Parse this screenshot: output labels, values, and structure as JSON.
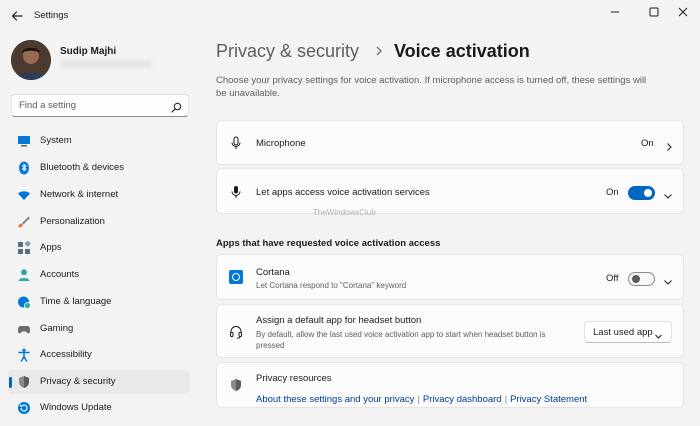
{
  "window": {
    "title": "Settings"
  },
  "user": {
    "name": "Sudip Majhi",
    "email": "sudipmajhi@hotmail.com"
  },
  "search": {
    "placeholder": "Find a setting"
  },
  "nav": [
    {
      "label": "System",
      "icon": "monitor-icon",
      "color": "#0078d4"
    },
    {
      "label": "Bluetooth & devices",
      "icon": "bluetooth-icon",
      "color": "#0078d4"
    },
    {
      "label": "Network & internet",
      "icon": "wifi-icon",
      "color": "#0078d4"
    },
    {
      "label": "Personalization",
      "icon": "paintbrush-icon",
      "color": "#e3733d"
    },
    {
      "label": "Apps",
      "icon": "apps-icon",
      "color": "#5c6b7a"
    },
    {
      "label": "Accounts",
      "icon": "person-icon",
      "color": "#2ea8a8"
    },
    {
      "label": "Time & language",
      "icon": "globe-clock-icon",
      "color": "#0078d4"
    },
    {
      "label": "Gaming",
      "icon": "gamepad-icon",
      "color": "#6b6b6b"
    },
    {
      "label": "Accessibility",
      "icon": "accessibility-icon",
      "color": "#0078d4"
    },
    {
      "label": "Privacy & security",
      "icon": "shield-icon",
      "color": "#6b6b6b",
      "selected": true
    },
    {
      "label": "Windows Update",
      "icon": "update-icon",
      "color": "#0078d4"
    }
  ],
  "breadcrumb": {
    "parent": "Privacy & security",
    "current": "Voice activation"
  },
  "description": "Choose your privacy settings for voice activation. If microphone access is turned off, these settings will be unavailable.",
  "microphone": {
    "label": "Microphone",
    "state": "On"
  },
  "voice_services": {
    "label": "Let apps access voice activation services",
    "state": "On",
    "enabled": true
  },
  "apps_section": {
    "heading": "Apps that have requested voice activation access"
  },
  "cortana": {
    "label": "Cortana",
    "description": "Let Cortana respond to \"Cortana\" keyword",
    "state": "Off",
    "enabled": false
  },
  "headset": {
    "label": "Assign a default app for headset button",
    "description": "By default, allow the last used voice activation app to start when headset button is pressed",
    "selected": "Last used app"
  },
  "resources": {
    "label": "Privacy resources",
    "links": [
      "About these settings and your privacy",
      "Privacy dashboard",
      "Privacy Statement"
    ]
  },
  "watermark": "TheWindowsClub",
  "colors": {
    "accent": "#0067c0",
    "link": "#003e92",
    "background": "#f3f3f3",
    "card": "#fbfbfb"
  }
}
